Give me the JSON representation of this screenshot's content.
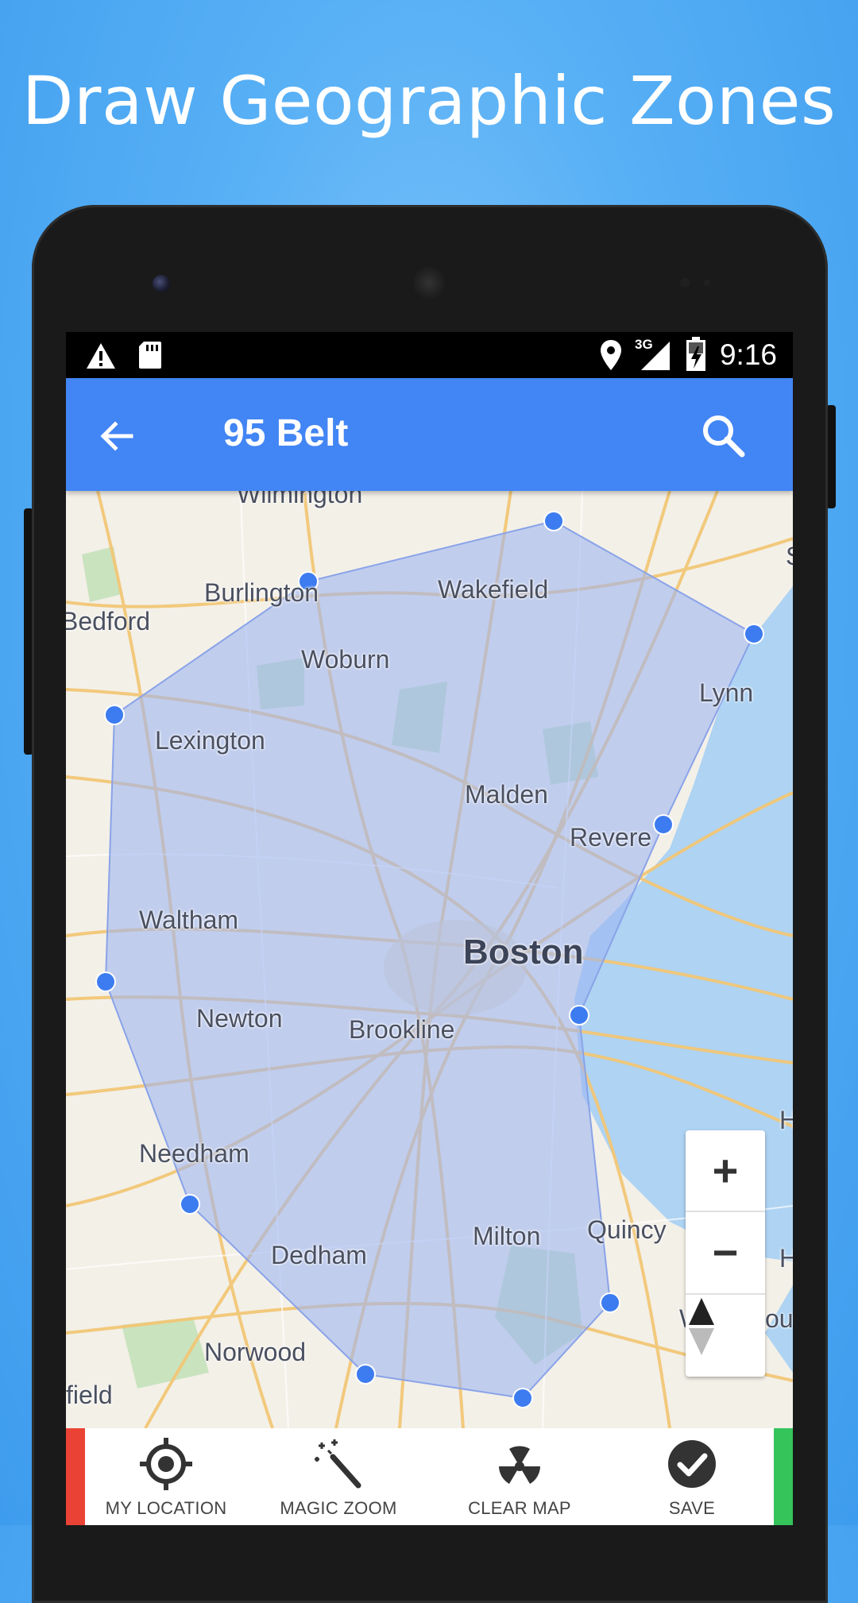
{
  "headline": "Draw Geographic Zones",
  "status_bar": {
    "time": "9:16",
    "network": "3G",
    "icons": [
      "warning-icon",
      "sd-card-icon",
      "location-icon",
      "signal-icon",
      "battery-charging-icon"
    ]
  },
  "app_bar": {
    "title": "95 Belt",
    "back_icon": "arrow-back-icon",
    "search_icon": "search-icon",
    "color": "#4285f4"
  },
  "map": {
    "places": [
      {
        "name": "Wilmington",
        "size": "small"
      },
      {
        "name": "Burlington",
        "size": "small"
      },
      {
        "name": "Wakefield",
        "size": "small"
      },
      {
        "name": "Bedford",
        "size": "small"
      },
      {
        "name": "Woburn",
        "size": "small"
      },
      {
        "name": "Lynn",
        "size": "small"
      },
      {
        "name": "Lexington",
        "size": "small"
      },
      {
        "name": "Malden",
        "size": "small"
      },
      {
        "name": "Revere",
        "size": "small"
      },
      {
        "name": "Waltham",
        "size": "small"
      },
      {
        "name": "Boston",
        "size": "big"
      },
      {
        "name": "Newton",
        "size": "small"
      },
      {
        "name": "Brookline",
        "size": "small"
      },
      {
        "name": "Needham",
        "size": "small"
      },
      {
        "name": "Milton",
        "size": "small"
      },
      {
        "name": "Quincy",
        "size": "small"
      },
      {
        "name": "Dedham",
        "size": "small"
      },
      {
        "name": "Norwood",
        "size": "small"
      },
      {
        "name": "field",
        "size": "small"
      },
      {
        "name": "H",
        "size": "small"
      },
      {
        "name": "H",
        "size": "small"
      },
      {
        "name": "W",
        "size": "small"
      },
      {
        "name": "ou",
        "size": "small"
      },
      {
        "name": "S",
        "size": "small"
      }
    ],
    "zone_fill": "#9bb3f2",
    "vertex_color": "#3d7cf0",
    "zoom_in_label": "+",
    "zoom_out_label": "−"
  },
  "bottom_actions": [
    {
      "label": "MY LOCATION",
      "icon": "my-location-icon"
    },
    {
      "label": "MAGIC ZOOM",
      "icon": "magic-wand-icon"
    },
    {
      "label": "CLEAR MAP",
      "icon": "radiation-icon"
    },
    {
      "label": "SAVE",
      "icon": "check-circle-icon"
    }
  ]
}
